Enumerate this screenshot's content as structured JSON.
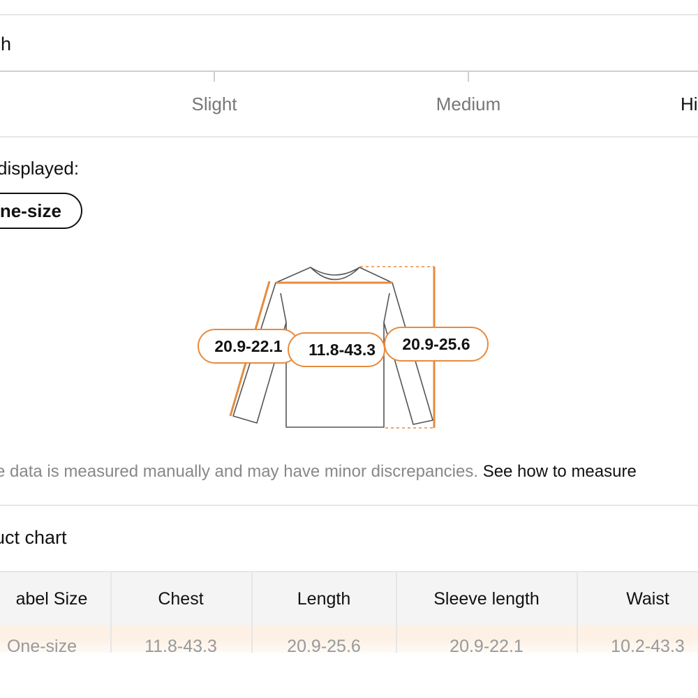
{
  "stretch": {
    "title": "tch",
    "levels": [
      "Slight",
      "Medium",
      "Hi"
    ]
  },
  "sizes": {
    "label": "displayed:",
    "selected": "ne-size"
  },
  "diagram": {
    "sleeve": "20.9-22.1",
    "chest": "11.8-43.3",
    "length": "20.9-25.6",
    "accent": "#e88a3c"
  },
  "disclaimer": {
    "text": "e data is measured manually and may have minor discrepancies. ",
    "link": "See how to measure"
  },
  "product_chart": {
    "title": "luct chart",
    "headers": [
      "abel Size",
      "Chest",
      "Length",
      "Sleeve length",
      "Waist"
    ],
    "row": [
      "One-size",
      "11.8-43.3",
      "20.9-25.6",
      "20.9-22.1",
      "10.2-43.3"
    ]
  }
}
